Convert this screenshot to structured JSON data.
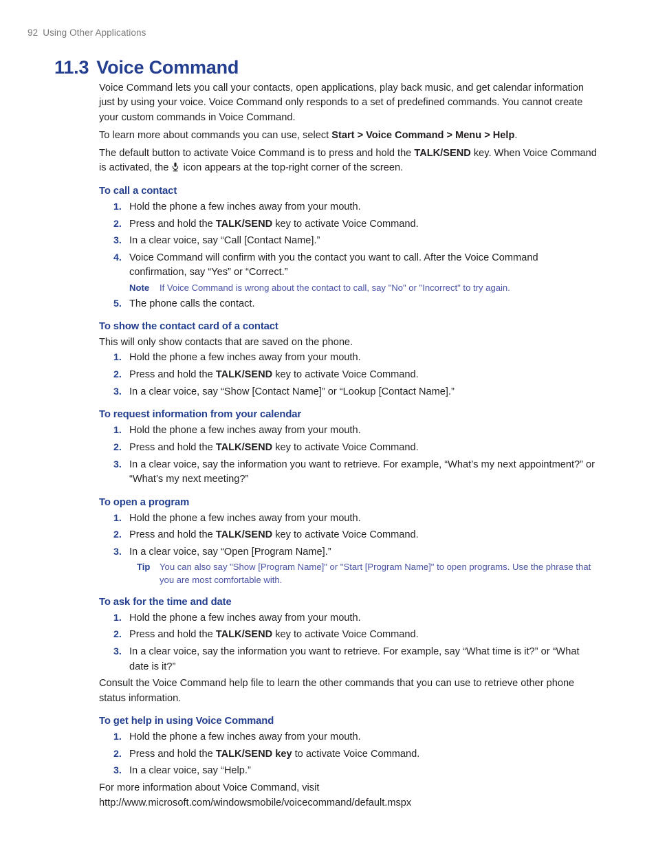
{
  "running_head": {
    "page_number": "92",
    "section": "Using Other Applications"
  },
  "chapter": {
    "number": "11.3",
    "title": "Voice Command"
  },
  "intro": {
    "paragraph_1": "Voice Command lets you call your contacts, open applications, play back music, and get calendar information just by using your voice. Voice Command only responds to a set of predefined commands. You cannot create your custom commands in Voice Command.",
    "paragraph_2_before": "To learn more about commands you can use, select ",
    "paragraph_2_bold": "Start > Voice Command > Menu > Help",
    "paragraph_2_after": ".",
    "paragraph_3_before": "The default button to activate Voice Command is to press and hold the ",
    "paragraph_3_bold": "TALK/SEND",
    "paragraph_3_mid": " key. When Voice Command is activated, the ",
    "paragraph_3_after": " icon appears at the top-right corner of the screen.",
    "mic_icon_name": "microphone-icon"
  },
  "sections": [
    {
      "heading": "To call a contact",
      "lead": "",
      "steps": [
        {
          "n": "1.",
          "before": "Hold the phone a few inches away from your mouth.",
          "bold": "",
          "after": ""
        },
        {
          "n": "2.",
          "before": "Press and hold the ",
          "bold": "TALK/SEND",
          "after": " key to activate Voice Command."
        },
        {
          "n": "3.",
          "before": "In a clear voice, say “Call [Contact Name].”",
          "bold": "",
          "after": ""
        },
        {
          "n": "4.",
          "before": "Voice Command will confirm with you the contact you want to call. After the Voice Command confirmation, say “Yes” or “Correct.”",
          "bold": "",
          "after": "",
          "callout": {
            "label": "Note",
            "text": "If Voice Command is wrong about the contact to call, say \"No\" or \"Incorrect\" to try again.",
            "kind": "note"
          }
        },
        {
          "n": "5.",
          "before": "The phone calls the contact.",
          "bold": "",
          "after": ""
        }
      ]
    },
    {
      "heading": "To show the contact card of a contact",
      "lead": "This will only show contacts that are saved on the phone.",
      "steps": [
        {
          "n": "1.",
          "before": "Hold the phone a few inches away from your mouth.",
          "bold": "",
          "after": ""
        },
        {
          "n": "2.",
          "before": "Press and hold the ",
          "bold": "TALK/SEND",
          "after": " key to activate Voice Command."
        },
        {
          "n": "3.",
          "before": "In a clear voice, say “Show [Contact Name]” or “Lookup [Contact Name].”",
          "bold": "",
          "after": ""
        }
      ]
    },
    {
      "heading": "To request information from your calendar",
      "lead": "",
      "steps": [
        {
          "n": "1.",
          "before": "Hold the phone a few inches away from your mouth.",
          "bold": "",
          "after": ""
        },
        {
          "n": "2.",
          "before": "Press and hold the ",
          "bold": "TALK/SEND",
          "after": " key to activate Voice Command."
        },
        {
          "n": "3.",
          "before": "In a clear voice, say the information you want to retrieve. For example, “What’s my next appointment?” or “What’s my next meeting?”",
          "bold": "",
          "after": ""
        }
      ]
    },
    {
      "heading": "To open a program",
      "lead": "",
      "steps": [
        {
          "n": "1.",
          "before": "Hold the phone a few inches away from your mouth.",
          "bold": "",
          "after": ""
        },
        {
          "n": "2.",
          "before": "Press and hold the ",
          "bold": "TALK/SEND",
          "after": " key to activate Voice Command."
        },
        {
          "n": "3.",
          "before": "In a clear voice, say “Open [Program Name].”",
          "bold": "",
          "after": "",
          "callout": {
            "label": "Tip",
            "text": "You can also say \"Show [Program Name]\" or \"Start [Program Name]\" to open programs. Use the phrase that you are most comfortable with.",
            "kind": "tip"
          }
        }
      ]
    },
    {
      "heading": "To ask for the time and date",
      "lead": "",
      "steps": [
        {
          "n": "1.",
          "before": "Hold the phone a few inches away from your mouth.",
          "bold": "",
          "after": ""
        },
        {
          "n": "2.",
          "before": "Press and hold the ",
          "bold": "TALK/SEND",
          "after": " key to activate Voice Command."
        },
        {
          "n": "3.",
          "before": "In a clear voice, say the information you want to retrieve. For example, say “What time is it?” or “What date is it?”",
          "bold": "",
          "after": ""
        }
      ],
      "after_text": "Consult the Voice Command help file to learn the other commands that you can use to retrieve other phone status information."
    },
    {
      "heading": "To get help in using Voice Command",
      "lead": "",
      "steps": [
        {
          "n": "1.",
          "before": "Hold the phone a few inches away from your mouth.",
          "bold": "",
          "after": ""
        },
        {
          "n": "2.",
          "before": "Press and hold the ",
          "bold": "TALK/SEND key",
          "after": " to activate Voice Command."
        },
        {
          "n": "3.",
          "before": "In a clear voice, say “Help.”",
          "bold": "",
          "after": ""
        }
      ]
    }
  ],
  "footer_paragraph": "For more information about Voice Command, visit http://www.microsoft.com/windowsmobile/voicecommand/default.mspx",
  "colors": {
    "heading_blue": "#243f8f",
    "callout_blue": "#4953a5",
    "body_text": "#231f20",
    "running_head_gray": "#7a7a7a"
  }
}
